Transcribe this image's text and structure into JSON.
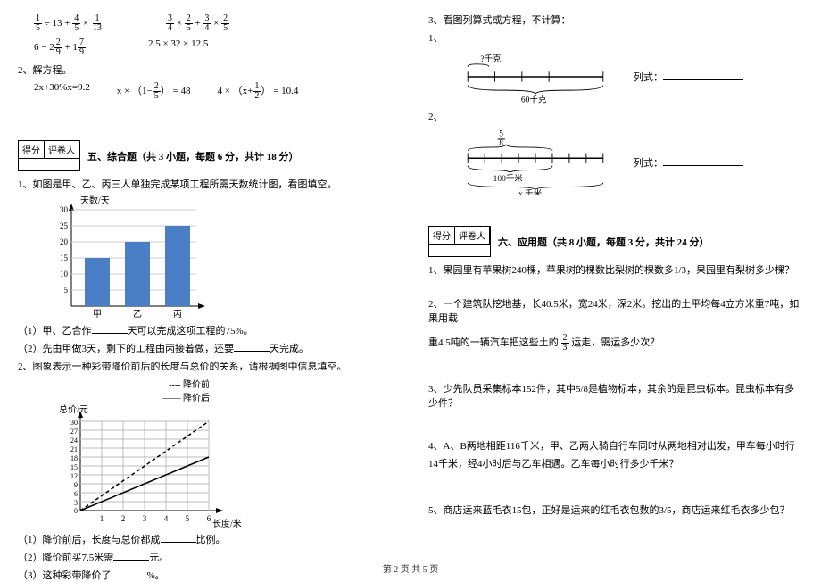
{
  "left": {
    "expr_row1_a_parts": {
      "f1n": "1",
      "f1d": "5",
      "op1": " ÷ 13 + ",
      "f2n": "4",
      "f2d": "5",
      "op2": " × ",
      "f3n": "1",
      "f3d": "13"
    },
    "expr_row1_b_parts": {
      "f1n": "3",
      "f1d": "4",
      "op1": " × ",
      "f2n": "2",
      "f2d": "5",
      "op2": " + ",
      "f3n": "3",
      "f3d": "4",
      "op3": " × ",
      "f4n": "2",
      "f4d": "5"
    },
    "expr_row2_a_parts": {
      "lead": "6 − 2",
      "f1n": "2",
      "f1d": "9",
      "mid": " + 1",
      "f2n": "7",
      "f2d": "9"
    },
    "expr_row2_b": "2.5 × 32 × 12.5",
    "q2_title": "2、解方程。",
    "eq1": "2x+30%x=9.2",
    "eq2_parts": {
      "lead": "x × （1−",
      "fn": "2",
      "fd": "5",
      "tail": "） = 48"
    },
    "eq3_parts": {
      "lead": "4 × （x+",
      "fn": "1",
      "fd": "2",
      "tail": "） = 10.4"
    },
    "score_label1": "得分",
    "score_label2": "评卷人",
    "section5_title": "五、综合题（共 3 小题，每题 6 分，共计 18 分）",
    "q5_1": "1、如图是甲、乙、丙三人单独完成某项工程所需天数统计图，看图填空。",
    "bar_axis_label": "天数/天",
    "bar_ticks": [
      "5",
      "10",
      "15",
      "20",
      "25",
      "30"
    ],
    "bar_cats": [
      "甲",
      "乙",
      "丙"
    ],
    "q5_1_1a": "（1）甲、乙合作",
    "q5_1_1b": "天可以完成这项工程的75%。",
    "q5_1_2a": "（2）先由甲做3天，剩下的工程由丙接着做，还要",
    "q5_1_2b": "天完成。",
    "q5_2": "2、图象表示一种彩带降价前后的长度与总价的关系，请根据图中信息填空。",
    "legend1": "---- 降价前",
    "legend2": "—— 降价后",
    "line_y_label": "总价/元",
    "line_x_label": "长度/米",
    "line_y_ticks": [
      "30",
      "27",
      "24",
      "21",
      "18",
      "15",
      "12",
      "9",
      "6",
      "3",
      "0"
    ],
    "line_x_ticks": [
      "1",
      "2",
      "3",
      "4",
      "5",
      "6"
    ],
    "q5_2_1": "（1）降价前后，长度与总价都成",
    "q5_2_1b": "比例。",
    "q5_2_2": "（2）降价前买7.5米需",
    "q5_2_2b": "元。",
    "q5_2_3": "（3）这种彩带降价了",
    "q5_2_3b": "%。"
  },
  "right": {
    "q3_title": "3、看图列算式或方程，不计算：",
    "sub1": "1、",
    "d1_top": "?千克",
    "d1_bottom": "60千克",
    "lieshi": "列式：",
    "sub2": "2、",
    "d2_top_fn": "5",
    "d2_top_fd": "8",
    "d2_mid": "100千米",
    "d2_bottom": "x 千米",
    "score_label1": "得分",
    "score_label2": "评卷人",
    "section6_title": "六、应用题（共 8 小题，每题 3 分，共计 24 分）",
    "q6_1": "1、果园里有苹果树240棵，苹果树的棵数比梨树的棵数多1/3，果园里有梨树多少棵？",
    "q6_2a": "2、一个建筑队挖地基，长40.5米，宽24米，深2米。挖出的土平均每4立方米重7吨，如果用载",
    "q6_2b_pre": "重4.5吨的一辆汽车把这些土的 ",
    "q6_2b_fn": "2",
    "q6_2b_fd": "3",
    "q6_2b_post": " 运走，需运多少次？",
    "q6_3": "3、少先队员采集标本152件，其中5/8是植物标本，其余的是昆虫标本。昆虫标本有多少件？",
    "q6_4": "4、A、B两地相距116千米，甲、乙两人骑自行车同时从两地相对出发，甲车每小时行14千米，经4小时后与乙车相遇。乙车每小时行多少千米？",
    "q6_5": "5、商店运来蓝毛衣15包，正好是运来的红毛衣包数的3/5，商店运来红毛衣多少包？"
  },
  "chart_data": [
    {
      "type": "bar",
      "title": "",
      "ylabel": "天数/天",
      "categories": [
        "甲",
        "乙",
        "丙"
      ],
      "values": [
        15,
        20,
        25
      ],
      "ylim": [
        0,
        30
      ]
    },
    {
      "type": "line",
      "title": "",
      "xlabel": "长度/米",
      "ylabel": "总价/元",
      "x": [
        0,
        1,
        2,
        3,
        4,
        5,
        6
      ],
      "series": [
        {
          "name": "降价前",
          "values": [
            0,
            5,
            10,
            15,
            20,
            25,
            30
          ]
        },
        {
          "name": "降价后",
          "values": [
            0,
            3,
            6,
            9,
            12,
            15,
            18
          ]
        }
      ],
      "xlim": [
        0,
        6
      ],
      "ylim": [
        0,
        30
      ]
    }
  ],
  "footer": "第 2 页 共 5 页"
}
